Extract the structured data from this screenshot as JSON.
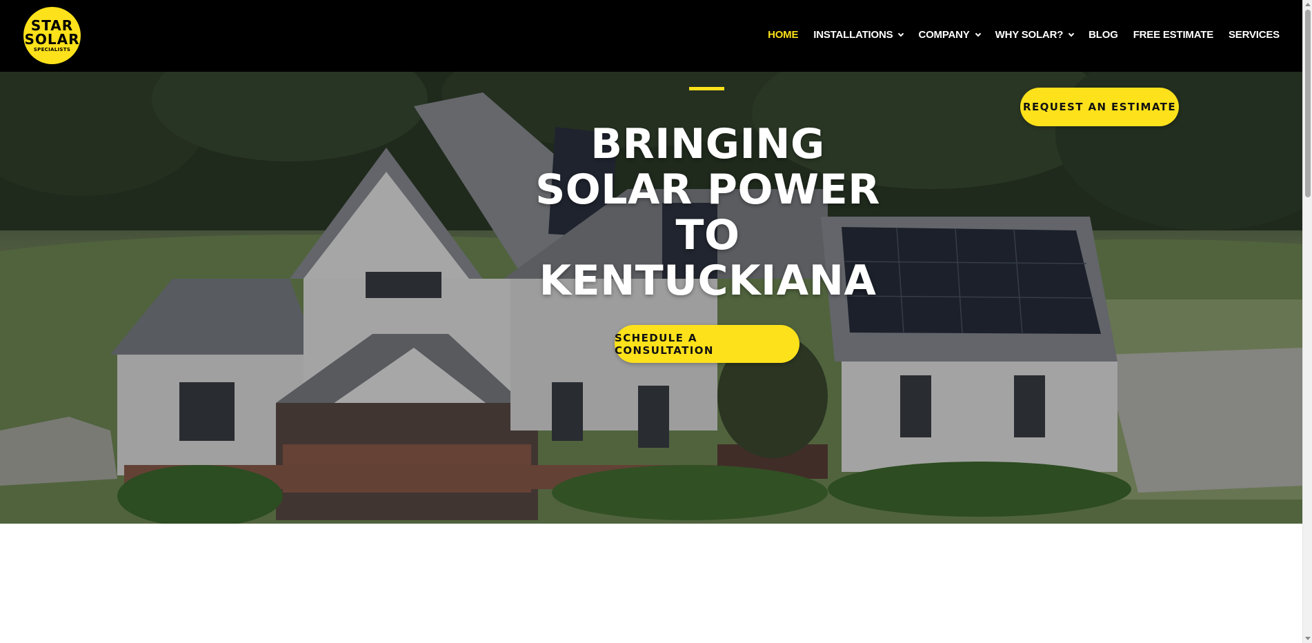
{
  "brand": {
    "logo_line1": "STAR",
    "logo_line2": "SOLAR",
    "logo_line3": "SPECIALISTS",
    "accent_color": "#fde11b",
    "header_bg": "#000000"
  },
  "nav": {
    "items": [
      {
        "label": "HOME",
        "active": true,
        "dropdown": false
      },
      {
        "label": "INSTALLATIONS",
        "active": false,
        "dropdown": true
      },
      {
        "label": "COMPANY",
        "active": false,
        "dropdown": true
      },
      {
        "label": "WHY SOLAR?",
        "active": false,
        "dropdown": true
      },
      {
        "label": "BLOG",
        "active": false,
        "dropdown": false
      },
      {
        "label": "FREE ESTIMATE",
        "active": false,
        "dropdown": false
      },
      {
        "label": "SERVICES",
        "active": false,
        "dropdown": false
      }
    ]
  },
  "hero": {
    "title_line1": "BRINGING",
    "title_line2": "SOLAR POWER",
    "title_line3": "TO",
    "title_line4": "KENTUCKIANA",
    "request_button": "REQUEST AN ESTIMATE",
    "consult_button": "SCHEDULE A CONSULTATION",
    "background_icon": "house-with-solar-panels-photo"
  }
}
